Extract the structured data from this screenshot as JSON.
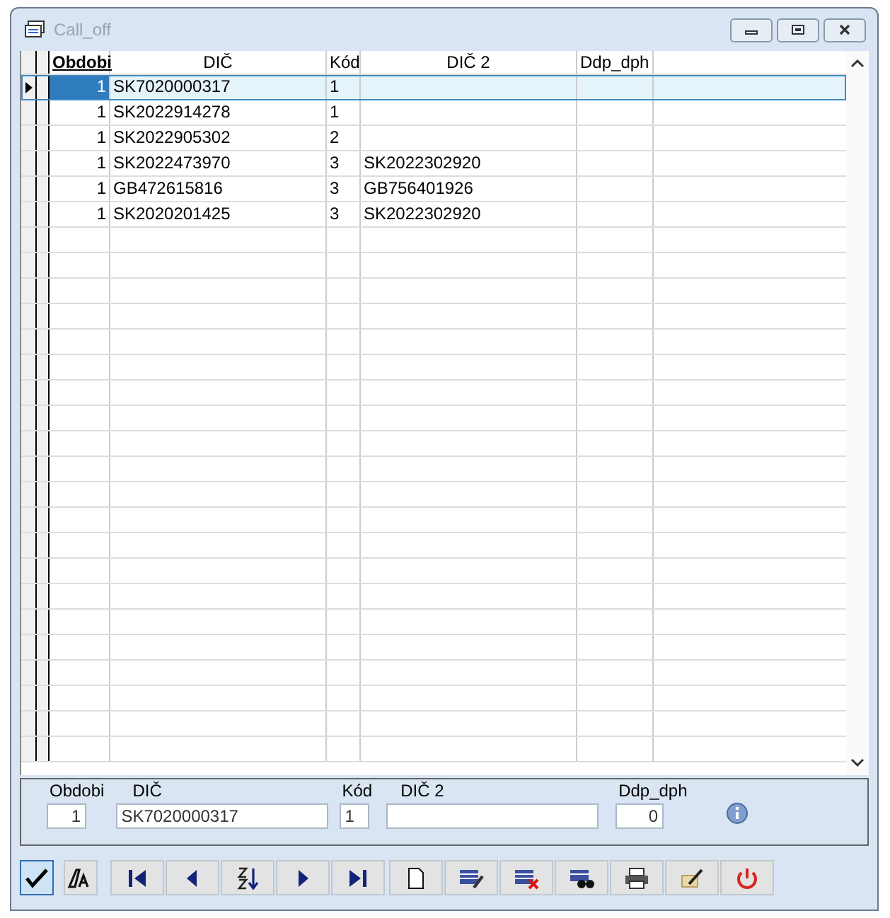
{
  "window": {
    "title": "Call_off"
  },
  "table": {
    "columns": [
      {
        "label": "Obdobi",
        "bold": true
      },
      {
        "label": "DIČ",
        "bold": false
      },
      {
        "label": "Kód",
        "bold": false
      },
      {
        "label": "DIČ 2",
        "bold": false
      },
      {
        "label": "Ddp_dph",
        "bold": false
      }
    ],
    "rows": [
      {
        "cells": [
          "1",
          "SK7020000317",
          "1",
          "",
          ""
        ],
        "selected": true
      },
      {
        "cells": [
          "1",
          "SK2022914278",
          "1",
          "",
          ""
        ],
        "selected": false
      },
      {
        "cells": [
          "1",
          "SK2022905302",
          "2",
          "",
          ""
        ],
        "selected": false
      },
      {
        "cells": [
          "1",
          "SK2022473970",
          "3",
          "SK2022302920",
          ""
        ],
        "selected": false
      },
      {
        "cells": [
          "1",
          "GB472615816",
          "3",
          "GB756401926",
          ""
        ],
        "selected": false
      },
      {
        "cells": [
          "1",
          "SK2020201425",
          "3",
          "SK2022302920",
          ""
        ],
        "selected": false
      }
    ]
  },
  "form": {
    "fields": [
      {
        "label": "Obdobi",
        "value": "1"
      },
      {
        "label": "DIČ",
        "value": "SK7020000317"
      },
      {
        "label": "Kód",
        "value": "1"
      },
      {
        "label": "DIČ 2"
      },
      {
        "label": "Ddp_dph",
        "value": "0"
      }
    ]
  },
  "toolbar": [
    {
      "kind": "check",
      "selected": true
    },
    {
      "kind": "font",
      "selected": false
    },
    {
      "kind": "first",
      "selected": false
    },
    {
      "kind": "prev",
      "selected": false
    },
    {
      "kind": "sort",
      "selected": false
    },
    {
      "kind": "next",
      "selected": false
    },
    {
      "kind": "last",
      "selected": false
    },
    {
      "kind": "new",
      "selected": false
    },
    {
      "kind": "edit",
      "selected": false
    },
    {
      "kind": "delete",
      "selected": false
    },
    {
      "kind": "find",
      "selected": false
    },
    {
      "kind": "print",
      "selected": false
    },
    {
      "kind": "tools",
      "selected": false
    },
    {
      "kind": "power",
      "selected": false
    }
  ]
}
